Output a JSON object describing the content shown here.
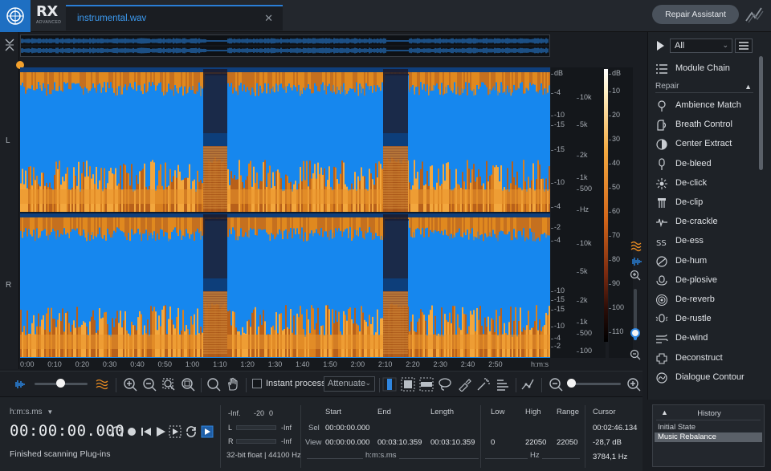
{
  "app": {
    "logo_text": "RX",
    "logo_sub": "ADVANCED",
    "file_tab": "instrumental.wav",
    "repair_assistant": "Repair Assistant"
  },
  "channels": {
    "left": "L",
    "right": "R"
  },
  "scales": {
    "db_left": [
      "dB",
      "-4",
      "-10",
      "-15",
      "-15",
      "-10",
      "-4",
      "-2",
      "-4",
      "-10",
      "-15",
      "-15",
      "-10",
      "-4",
      "-2"
    ],
    "hz": [
      "10k",
      "5k",
      "2k",
      "1k",
      "500",
      "Hz",
      "10k",
      "5k",
      "2k",
      "1k",
      "500",
      "100"
    ],
    "db_right": [
      "dB",
      "10",
      "20",
      "30",
      "40",
      "50",
      "60",
      "70",
      "80",
      "90",
      "100",
      "110"
    ]
  },
  "time_axis": [
    "0:00",
    "0:10",
    "0:20",
    "0:30",
    "0:40",
    "0:50",
    "1:00",
    "1:10",
    "1:20",
    "1:30",
    "1:40",
    "1:50",
    "2:00",
    "2:10",
    "2:20",
    "2:30",
    "2:40",
    "2:50",
    "h:m:s"
  ],
  "toolbar": {
    "instant_process": "Instant process",
    "attenuate": "Attenuate"
  },
  "transport": {
    "time_format": "h:m:s.ms",
    "time": "00:00:00.000",
    "status": "Finished scanning Plug-ins"
  },
  "meter": {
    "scale": [
      "-Inf.",
      "-20",
      "0"
    ],
    "left_label": "L",
    "right_label": "R",
    "left_value": "-Inf",
    "right_value": "-Inf",
    "format": "32-bit float | 44100 Hz"
  },
  "selection": {
    "headers": [
      "Start",
      "End",
      "Length",
      "Low",
      "High",
      "Range",
      "Cursor"
    ],
    "sel_label": "Sel",
    "view_label": "View",
    "sel_start": "00:00:00.000",
    "view_start": "00:00:00.000",
    "view_end": "00:03:10.359",
    "view_length": "00:03:10.359",
    "low": "0",
    "high": "22050",
    "range": "22050",
    "cursor_time": "00:02:46.134",
    "cursor_db": "-28,7 dB",
    "cursor_hz": "3784,1 Hz",
    "unit_time": "h:m:s.ms",
    "unit_hz": "Hz"
  },
  "modules": {
    "filter": "All",
    "module_chain": "Module Chain",
    "section": "Repair",
    "items": [
      "Ambience Match",
      "Breath Control",
      "Center Extract",
      "De-bleed",
      "De-click",
      "De-clip",
      "De-crackle",
      "De-ess",
      "De-hum",
      "De-plosive",
      "De-reverb",
      "De-rustle",
      "De-wind",
      "Deconstruct",
      "Dialogue Contour"
    ]
  },
  "history": {
    "title": "History",
    "items": [
      "Initial State",
      "Music Rebalance"
    ]
  },
  "colors": {
    "accent": "#2a7ed6",
    "spectrum_blue": "#1488f0",
    "spectrum_orange": "#e58a22"
  }
}
